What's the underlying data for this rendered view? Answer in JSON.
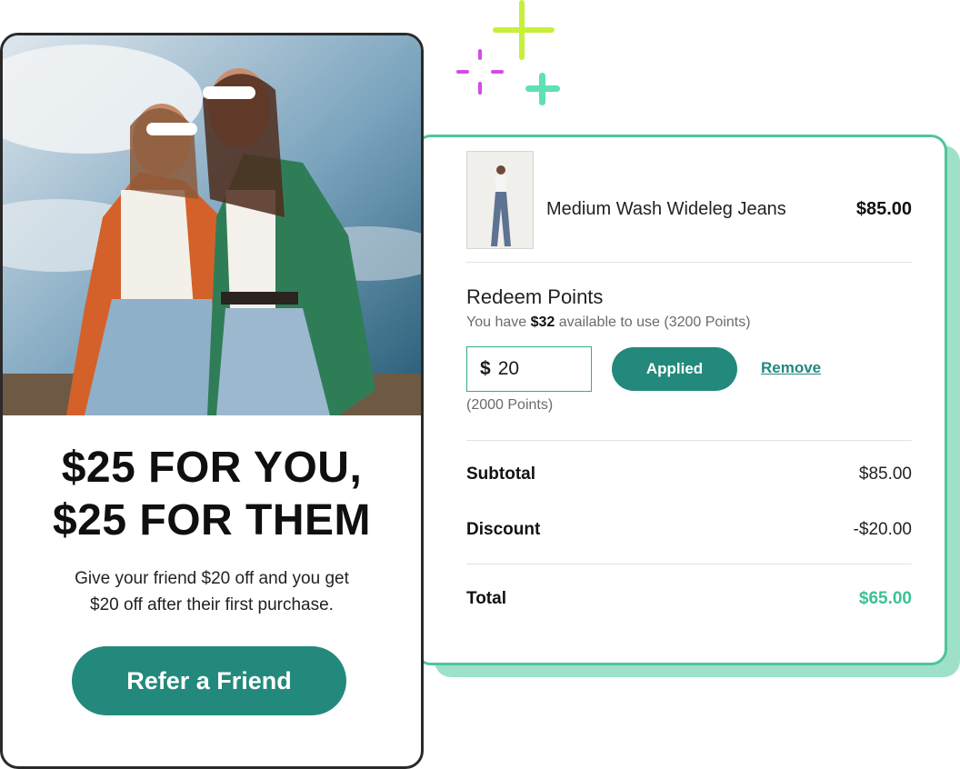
{
  "promo": {
    "headline_line1": "$25 FOR YOU,",
    "headline_line2": "$25 FOR THEM",
    "body_line1": "Give your friend $20 off and you get",
    "body_line2": "$20 off after their first purchase.",
    "cta_label": "Refer a Friend"
  },
  "cart": {
    "item": {
      "name": "Medium Wash Wideleg Jeans",
      "price": "$85.00"
    },
    "redeem": {
      "title": "Redeem Points",
      "sub_prefix": "You have ",
      "sub_amount": "$32",
      "sub_suffix": " available to use (3200 Points)",
      "currency": "$",
      "amount": "20",
      "applied_label": "Applied",
      "remove_label": "Remove",
      "points_note": "(2000 Points)"
    },
    "summary": {
      "subtotal_label": "Subtotal",
      "subtotal_value": "$85.00",
      "discount_label": "Discount",
      "discount_value": "-$20.00",
      "total_label": "Total",
      "total_value": "$65.00"
    }
  },
  "colors": {
    "brand_teal": "#23897c",
    "accent_green": "#3cc194",
    "card_border": "#4cc59b",
    "sparkle_lime": "#c6f03a",
    "sparkle_magenta": "#d64be6",
    "sparkle_mint": "#5fe0b5"
  },
  "icons": [
    "sparkle-plus-lime-icon",
    "sparkle-plus-mint-icon",
    "sparkle-dashed-magenta-icon"
  ]
}
